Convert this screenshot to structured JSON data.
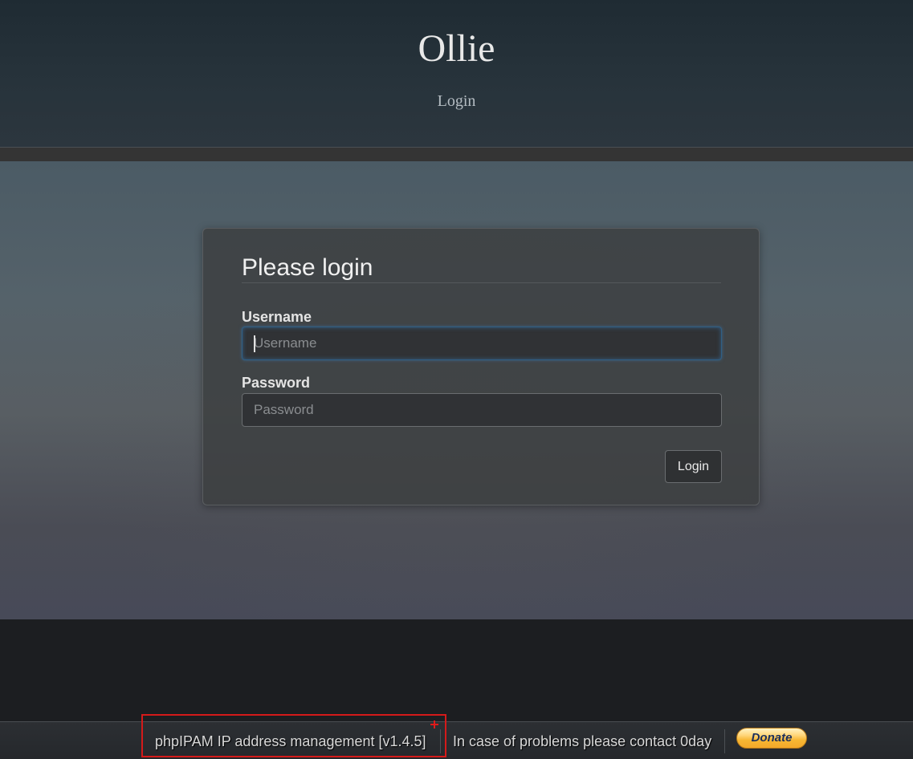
{
  "header": {
    "title": "Ollie",
    "subtitle": "Login"
  },
  "login_form": {
    "heading": "Please login",
    "username": {
      "label": "Username",
      "placeholder": "Username",
      "value": ""
    },
    "password": {
      "label": "Password",
      "placeholder": "Password",
      "value": ""
    },
    "submit_label": "Login"
  },
  "footer": {
    "version_text": "phpIPAM IP address management [v1.4.5]",
    "contact_text": "In case of problems please contact 0day",
    "donate_label": "Donate"
  },
  "colors": {
    "highlight": "#d41a1a",
    "focus_ring": "#2f5f86",
    "donate_bg": "#f7b733",
    "donate_text": "#1b2f5c"
  }
}
